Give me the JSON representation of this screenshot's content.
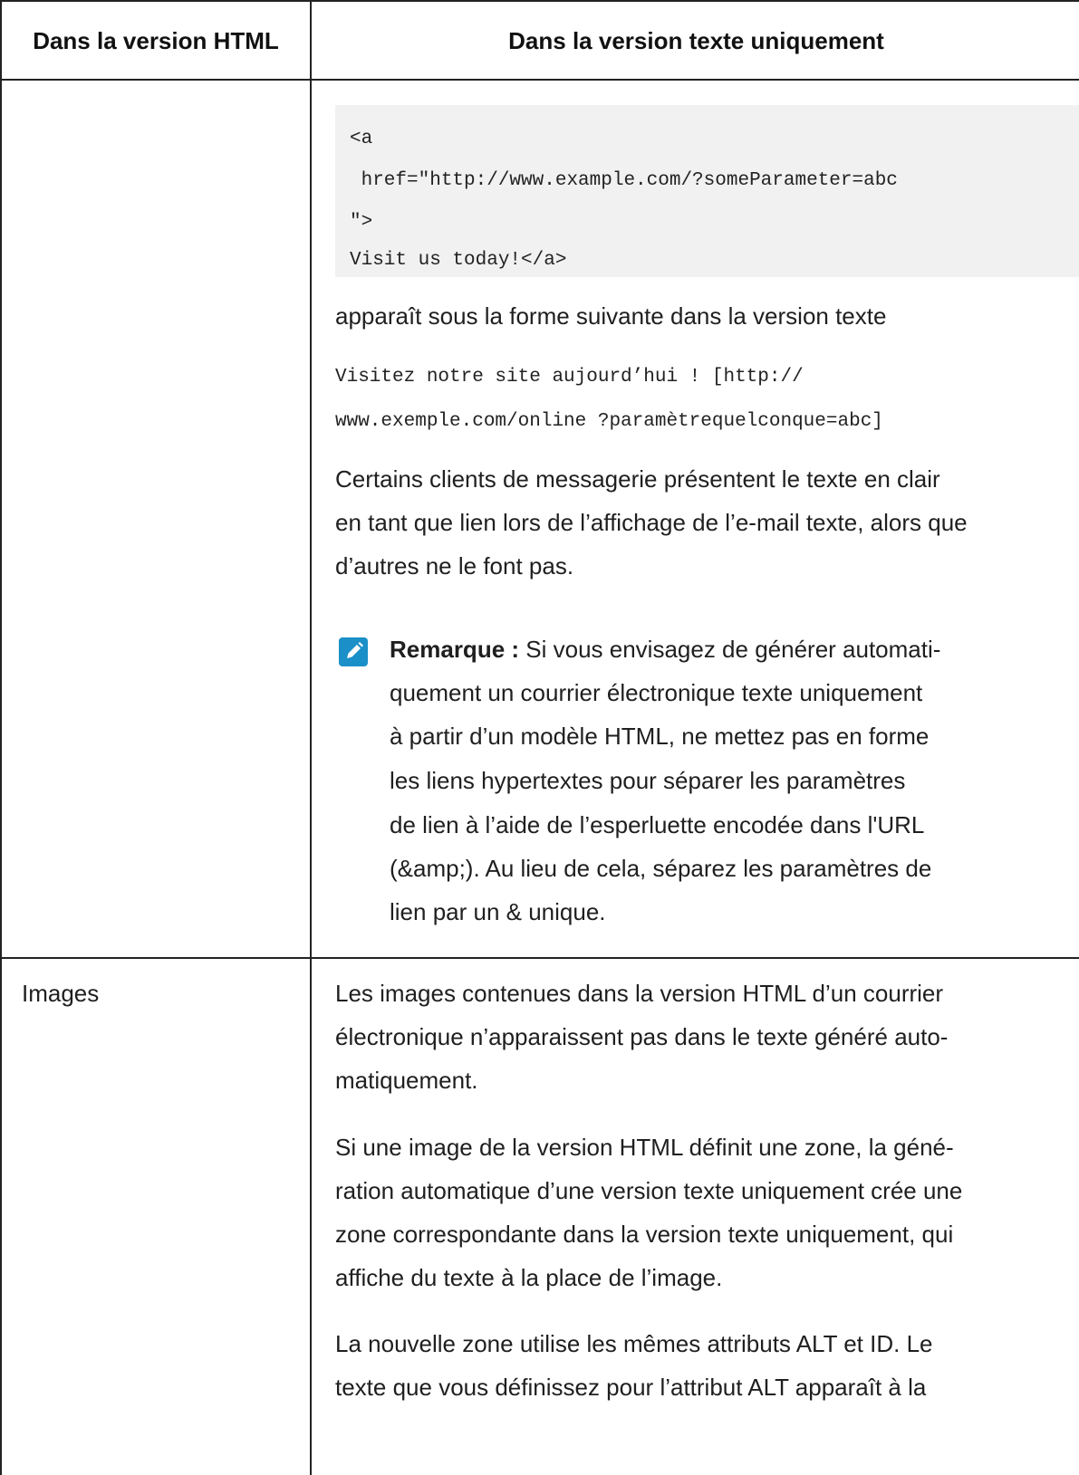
{
  "table": {
    "headers": [
      "Dans la version HTML",
      "Dans la version texte uniquement"
    ]
  },
  "row1": {
    "code_lines": [
      "<a",
      " href=\"http://www.example.com/?someParameter=abc",
      "\">",
      "Visit us today!</a>"
    ],
    "intro": "apparaît sous la forme suivante dans la version texte",
    "output_lines": [
      "Visitez notre site aujourd’hui ! [http://",
      "www.exemple.com/online ?paramètrequelconque=abc]"
    ],
    "para_lines": [
      "Certains clients de messagerie présentent le texte en clair",
      "en tant que lien lors de l’affichage de l’e-mail texte, alors que",
      "d’autres ne le font pas."
    ],
    "note": {
      "icon": "pencil-note-icon",
      "label": "Remarque :",
      "first_line_rest": " Si vous envisagez de générer automati-",
      "lines": [
        "quement un courrier électronique texte uniquement",
        "à partir d’un modèle HTML, ne mettez pas en forme",
        "les liens hypertextes pour séparer les paramètres",
        "de lien à l’aide de l’esperluette encodée dans l'URL",
        "(&amp;). Au lieu de cela, séparez les paramètres de",
        "lien par un & unique."
      ]
    }
  },
  "row2": {
    "label": "Images",
    "para1_lines": [
      "Les images contenues dans la version HTML d’un courrier",
      "électronique n’apparaissent pas dans le texte généré auto-",
      "matiquement."
    ],
    "para2_lines": [
      "Si une image de la version HTML définit une zone, la géné-",
      "ration automatique d’une version texte uniquement crée une",
      "zone correspondante dans la version texte uniquement, qui",
      "affiche du texte à la place de l’image."
    ],
    "para3_lines": [
      "La nouvelle zone utilise les mêmes attributs ALT et ID. Le",
      "texte que vous définissez pour l’attribut ALT apparaît à la"
    ]
  },
  "colors": {
    "note_icon": "#1a8fc8",
    "code_background": "#f1f1f1",
    "border": "#222222"
  }
}
